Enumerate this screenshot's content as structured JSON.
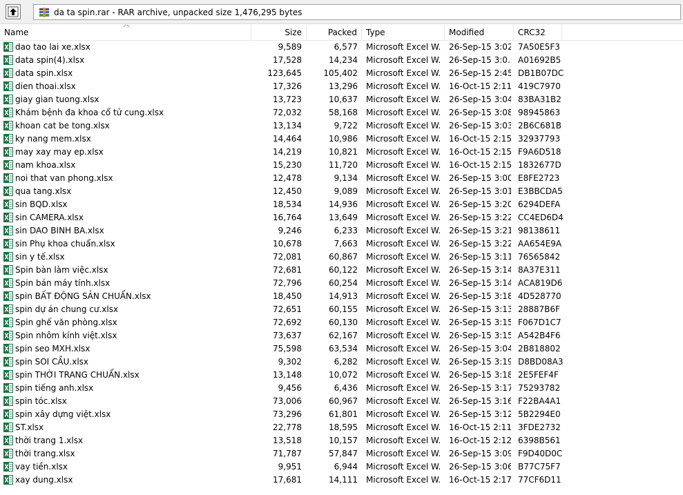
{
  "toolbar": {
    "path_text": "da ta spin.rar - RAR archive, unpacked size 1,476,295 bytes"
  },
  "columns": {
    "name": "Name",
    "size": "Size",
    "packed": "Packed",
    "type": "Type",
    "modified": "Modified",
    "crc": "CRC32"
  },
  "files": [
    {
      "name": "dao tao lai xe.xlsx",
      "size": "9,589",
      "packed": "6,577",
      "type": "Microsoft Excel W...",
      "modified": "26-Sep-15 3:02...",
      "crc": "7A50E5F3"
    },
    {
      "name": "data spin(4).xlsx",
      "size": "17,528",
      "packed": "14,234",
      "type": "Microsoft Excel W...",
      "modified": "26-Sep-15 3:0...",
      "crc": "A01692B5"
    },
    {
      "name": "data spin.xlsx",
      "size": "123,645",
      "packed": "105,402",
      "type": "Microsoft Excel W...",
      "modified": "26-Sep-15 2:45...",
      "crc": "DB1B07DC"
    },
    {
      "name": "dien thoai.xlsx",
      "size": "17,326",
      "packed": "13,296",
      "type": "Microsoft Excel W...",
      "modified": "16-Oct-15 2:11...",
      "crc": "419C7970"
    },
    {
      "name": "giay gian tuong.xlsx",
      "size": "13,723",
      "packed": "10,637",
      "type": "Microsoft Excel W...",
      "modified": "26-Sep-15 3:04...",
      "crc": "83BA31B2"
    },
    {
      "name": "Khám bệnh đa khoa cổ tử cung.xlsx",
      "size": "72,032",
      "packed": "58,168",
      "type": "Microsoft Excel W...",
      "modified": "26-Sep-15 3:08...",
      "crc": "98945863"
    },
    {
      "name": "khoan cat be tong.xlsx",
      "size": "13,134",
      "packed": "9,722",
      "type": "Microsoft Excel W...",
      "modified": "26-Sep-15 3:03...",
      "crc": "2B6C681B"
    },
    {
      "name": "ky nang mem.xlsx",
      "size": "14,464",
      "packed": "10,986",
      "type": "Microsoft Excel W...",
      "modified": "16-Oct-15 2:15...",
      "crc": "32937793"
    },
    {
      "name": "may xay may ep.xlsx",
      "size": "14,219",
      "packed": "10,821",
      "type": "Microsoft Excel W...",
      "modified": "16-Oct-15 2:15...",
      "crc": "F9A6D518"
    },
    {
      "name": "nam khoa.xlsx",
      "size": "15,230",
      "packed": "11,720",
      "type": "Microsoft Excel W...",
      "modified": "16-Oct-15 2:15...",
      "crc": "1832677D"
    },
    {
      "name": "noi that van phong.xlsx",
      "size": "12,478",
      "packed": "9,134",
      "type": "Microsoft Excel W...",
      "modified": "26-Sep-15 3:00...",
      "crc": "E8FE2723"
    },
    {
      "name": "qua tang.xlsx",
      "size": "12,450",
      "packed": "9,089",
      "type": "Microsoft Excel W...",
      "modified": "26-Sep-15 3:01...",
      "crc": "E3BBCDA5"
    },
    {
      "name": "sin BQD.xlsx",
      "size": "18,534",
      "packed": "14,936",
      "type": "Microsoft Excel W...",
      "modified": "26-Sep-15 3:20...",
      "crc": "6294DEFA"
    },
    {
      "name": "sin CAMERA.xlsx",
      "size": "16,764",
      "packed": "13,649",
      "type": "Microsoft Excel W...",
      "modified": "26-Sep-15 3:22...",
      "crc": "CC4ED6D4"
    },
    {
      "name": "sin DAO BINH BA.xlsx",
      "size": "9,246",
      "packed": "6,233",
      "type": "Microsoft Excel W...",
      "modified": "26-Sep-15 3:21...",
      "crc": "98138611"
    },
    {
      "name": "sin Phụ khoa chuẩn.xlsx",
      "size": "10,678",
      "packed": "7,663",
      "type": "Microsoft Excel W...",
      "modified": "26-Sep-15 3:22...",
      "crc": "AA654E9A"
    },
    {
      "name": "sin y tế.xlsx",
      "size": "72,081",
      "packed": "60,867",
      "type": "Microsoft Excel W...",
      "modified": "26-Sep-15 3:11...",
      "crc": "76565842"
    },
    {
      "name": "Spin bàn làm việc.xlsx",
      "size": "72,681",
      "packed": "60,122",
      "type": "Microsoft Excel W...",
      "modified": "26-Sep-15 3:14...",
      "crc": "8A37E311"
    },
    {
      "name": "Spin bán máy tính.xlsx",
      "size": "72,796",
      "packed": "60,254",
      "type": "Microsoft Excel W...",
      "modified": "26-Sep-15 3:14...",
      "crc": "ACA819D6"
    },
    {
      "name": "spin BẤT ĐỘNG SẢN CHUẨN.xlsx",
      "size": "18,450",
      "packed": "14,913",
      "type": "Microsoft Excel W...",
      "modified": "26-Sep-15 3:18...",
      "crc": "4D528770"
    },
    {
      "name": "spin dự án chung cư.xlsx",
      "size": "72,651",
      "packed": "60,155",
      "type": "Microsoft Excel W...",
      "modified": "26-Sep-15 3:13...",
      "crc": "28887B6F"
    },
    {
      "name": "Spin ghế văn phòng.xlsx",
      "size": "72,692",
      "packed": "60,130",
      "type": "Microsoft Excel W...",
      "modified": "26-Sep-15 3:15...",
      "crc": "F067D1C7"
    },
    {
      "name": "Spin nhôm kính việt.xlsx",
      "size": "73,637",
      "packed": "62,167",
      "type": "Microsoft Excel W...",
      "modified": "26-Sep-15 3:15...",
      "crc": "A542B4F6"
    },
    {
      "name": "spin seo MXH.xlsx",
      "size": "75,598",
      "packed": "63,534",
      "type": "Microsoft Excel W...",
      "modified": "26-Sep-15 3:04...",
      "crc": "2B818802"
    },
    {
      "name": "spin SOI CẦU.xlsx",
      "size": "9,302",
      "packed": "6,282",
      "type": "Microsoft Excel W...",
      "modified": "26-Sep-15 3:19...",
      "crc": "D8BD08A3"
    },
    {
      "name": "spin THỜI TRANG CHUẨN.xlsx",
      "size": "13,148",
      "packed": "10,072",
      "type": "Microsoft Excel W...",
      "modified": "26-Sep-15 3:18...",
      "crc": "2E5FEF4F"
    },
    {
      "name": "spin tiếng anh.xlsx",
      "size": "9,456",
      "packed": "6,436",
      "type": "Microsoft Excel W...",
      "modified": "26-Sep-15 3:17...",
      "crc": "75293782"
    },
    {
      "name": "spin tóc.xlsx",
      "size": "73,006",
      "packed": "60,967",
      "type": "Microsoft Excel W...",
      "modified": "26-Sep-15 3:16...",
      "crc": "F22BA4A1"
    },
    {
      "name": "spin xây dựng việt.xlsx",
      "size": "73,296",
      "packed": "61,801",
      "type": "Microsoft Excel W...",
      "modified": "26-Sep-15 3:12...",
      "crc": "5B2294E0"
    },
    {
      "name": "ST.xlsx",
      "size": "22,778",
      "packed": "18,595",
      "type": "Microsoft Excel W...",
      "modified": "16-Oct-15 2:11...",
      "crc": "3FDE2732"
    },
    {
      "name": "thời trang 1.xlsx",
      "size": "13,518",
      "packed": "10,157",
      "type": "Microsoft Excel W...",
      "modified": "16-Oct-15 2:12...",
      "crc": "6398B561"
    },
    {
      "name": "thời trang.xlsx",
      "size": "71,787",
      "packed": "57,847",
      "type": "Microsoft Excel W...",
      "modified": "26-Sep-15 3:09...",
      "crc": "F9D40D0C"
    },
    {
      "name": "vay tiền.xlsx",
      "size": "9,951",
      "packed": "6,944",
      "type": "Microsoft Excel W...",
      "modified": "26-Sep-15 3:06...",
      "crc": "B77C75F7"
    },
    {
      "name": "xay dung.xlsx",
      "size": "17,681",
      "packed": "14,111",
      "type": "Microsoft Excel W...",
      "modified": "16-Oct-15 2:17...",
      "crc": "77CF6D11"
    }
  ],
  "icons": {
    "up": "up-folder-icon",
    "archive": "rar-archive-icon",
    "file": "excel-file-icon",
    "sort": "sort-ascending-icon"
  },
  "colors": {
    "excel_green": "#1e7145",
    "toolbar_bg": "#f0f0f0"
  }
}
